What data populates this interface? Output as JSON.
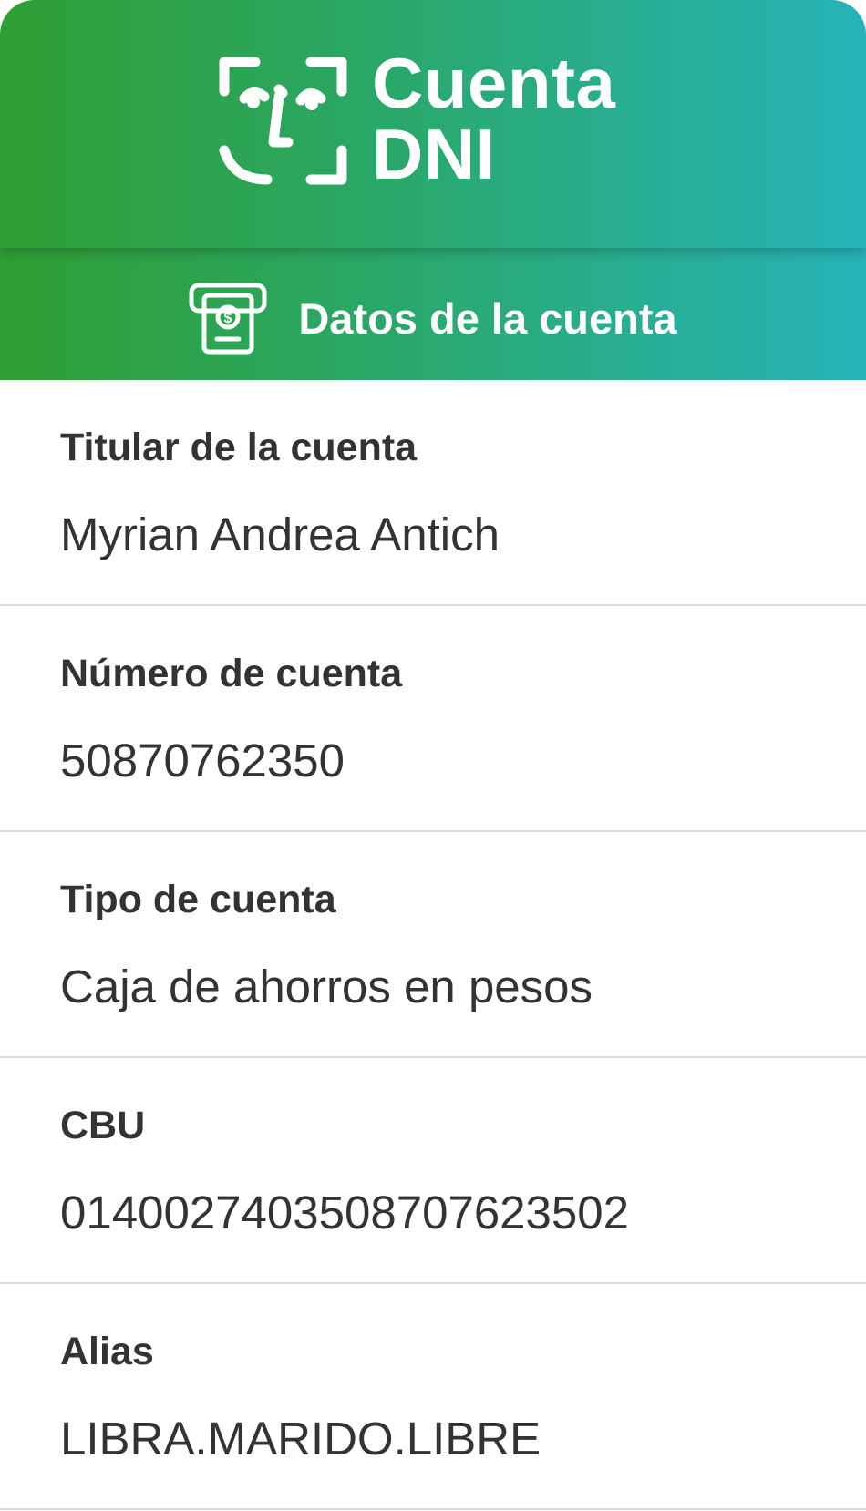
{
  "brand": {
    "logo_line1": "Cuenta",
    "logo_line2": "DNI",
    "logo_icon": "face-scan-icon",
    "gradient_start": "#2f9e32",
    "gradient_end": "#27b3b9"
  },
  "section": {
    "title": "Datos de la cuenta",
    "icon": "atm-cash-icon"
  },
  "fields": [
    {
      "label": "Titular de la cuenta",
      "value": "Myrian Andrea Antich"
    },
    {
      "label": "Número de cuenta",
      "value": "50870762350"
    },
    {
      "label": "Tipo de cuenta",
      "value": "Caja de ahorros en pesos"
    },
    {
      "label": "CBU",
      "value": "0140027403508707623502"
    },
    {
      "label": "Alias",
      "value": "LIBRA.MARIDO.LIBRE"
    }
  ]
}
